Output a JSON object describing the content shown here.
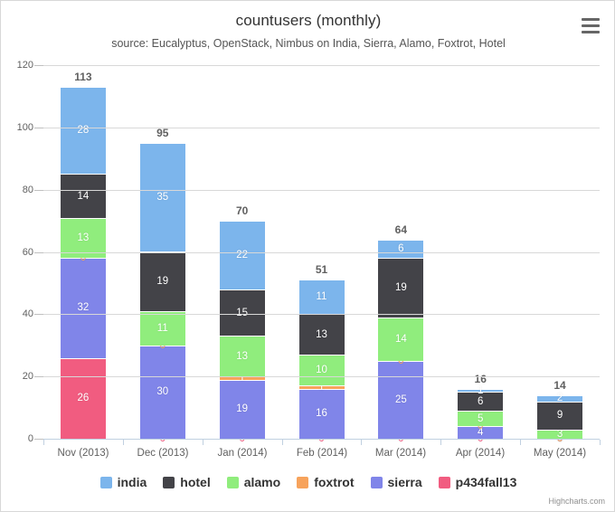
{
  "chart_data": {
    "type": "bar",
    "stacked": true,
    "title": "countusers (monthly)",
    "subtitle": "source: Eucalyptus, OpenStack, Nimbus on India, Sierra, Alamo, Foxtrot, Hotel",
    "xlabel": "",
    "ylabel": "",
    "ylim": [
      0,
      120
    ],
    "ytick_step": 20,
    "yticks": [
      0,
      20,
      40,
      60,
      80,
      100,
      120
    ],
    "grid": true,
    "legend_position": "bottom",
    "categories": [
      "Nov (2013)",
      "Dec (2013)",
      "Jan (2014)",
      "Feb (2014)",
      "Mar (2014)",
      "Apr (2014)",
      "May (2014)"
    ],
    "stack_totals": [
      113,
      95,
      70,
      51,
      64,
      16,
      14
    ],
    "series": [
      {
        "name": "india",
        "color": "#7CB5EC",
        "values": [
          28,
          35,
          22,
          11,
          6,
          1,
          2
        ]
      },
      {
        "name": "hotel",
        "color": "#434348",
        "values": [
          14,
          19,
          15,
          13,
          19,
          6,
          9
        ]
      },
      {
        "name": "alamo",
        "color": "#90ED7D",
        "values": [
          13,
          11,
          13,
          10,
          14,
          5,
          3
        ]
      },
      {
        "name": "foxtrot",
        "color": "#F7A35C",
        "values": [
          0,
          0,
          1,
          1,
          0,
          0,
          0
        ]
      },
      {
        "name": "sierra",
        "color": "#8085E9",
        "values": [
          32,
          30,
          19,
          16,
          25,
          4,
          0
        ]
      },
      {
        "name": "p434fall13",
        "color": "#F15C80",
        "values": [
          26,
          0,
          0,
          0,
          0,
          0,
          0
        ]
      }
    ]
  },
  "context_menu": {
    "name": "chart-context-menu"
  },
  "credits": {
    "text": "Highcharts.com"
  }
}
